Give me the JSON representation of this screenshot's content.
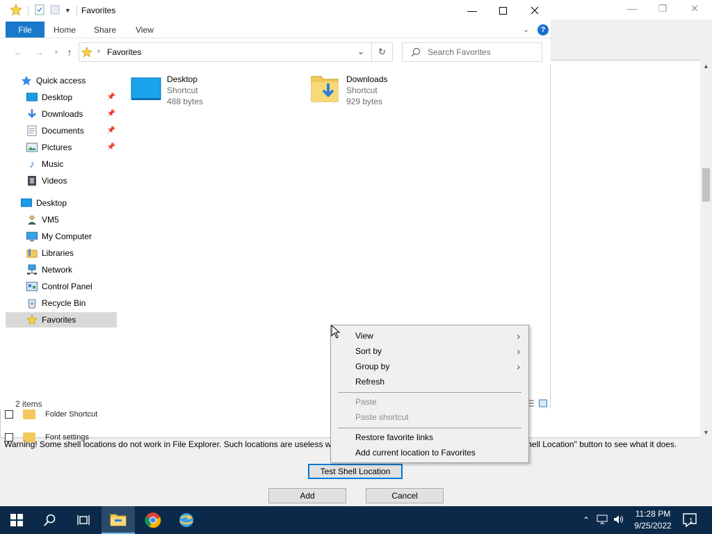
{
  "background_dialog": {
    "list_rows": [
      {
        "label": "Folder Shortcut"
      },
      {
        "label": "Font settings"
      }
    ],
    "warning_text": "Warning! Some shell locations do not work in File Explorer. Such locations are useless when added                                                                                              est the selected location using the \"Test Shell Location\" button to see what it does.",
    "test_shell_label": "Test Shell Location",
    "add_label": "Add",
    "cancel_label": "Cancel"
  },
  "explorer": {
    "title": "Favorites",
    "ribbon_tabs": [
      "File",
      "Home",
      "Share",
      "View"
    ],
    "address_path": "Favorites",
    "search_placeholder": "Search Favorites",
    "nav_items": [
      {
        "label": "Quick access",
        "icon": "star-blue-icon"
      },
      {
        "label": "Desktop",
        "icon": "desktop-icon",
        "pinned": true
      },
      {
        "label": "Downloads",
        "icon": "downloads-icon",
        "pinned": true
      },
      {
        "label": "Documents",
        "icon": "documents-icon",
        "pinned": true
      },
      {
        "label": "Pictures",
        "icon": "pictures-icon",
        "pinned": true
      },
      {
        "label": "Music",
        "icon": "music-icon"
      },
      {
        "label": "Videos",
        "icon": "videos-icon"
      },
      {
        "label": "Desktop",
        "icon": "desktop-icon"
      },
      {
        "label": "VM5",
        "icon": "user-icon"
      },
      {
        "label": "My Computer",
        "icon": "computer-icon"
      },
      {
        "label": "Libraries",
        "icon": "libraries-icon"
      },
      {
        "label": "Network",
        "icon": "network-icon"
      },
      {
        "label": "Control Panel",
        "icon": "control-panel-icon"
      },
      {
        "label": "Recycle Bin",
        "icon": "recycle-bin-icon"
      },
      {
        "label": "Favorites",
        "icon": "favorites-star-icon",
        "selected": true
      }
    ],
    "files": [
      {
        "name": "Desktop",
        "type": "Shortcut",
        "size": "488 bytes",
        "icon": "desktop-icon"
      },
      {
        "name": "Downloads",
        "type": "Shortcut",
        "size": "929 bytes",
        "icon": "downloads-folder-icon"
      }
    ],
    "status": "2 items"
  },
  "context_menu": {
    "items": [
      {
        "label": "View",
        "submenu": true
      },
      {
        "label": "Sort by",
        "submenu": true
      },
      {
        "label": "Group by",
        "submenu": true
      },
      {
        "label": "Refresh"
      },
      {
        "label": "Paste",
        "disabled": true
      },
      {
        "label": "Paste shortcut",
        "disabled": true
      },
      {
        "label": "Restore favorite links"
      },
      {
        "label": "Add current location to Favorites"
      }
    ]
  },
  "taskbar": {
    "clock_time": "11:28 PM",
    "clock_date": "9/25/2022",
    "notification_count": "1"
  },
  "colors": {
    "file_tab": "#1979ca",
    "taskbar": "#0b2a4a",
    "selected_nav": "#d9d9d9",
    "accent_blue": "#0078d7"
  }
}
